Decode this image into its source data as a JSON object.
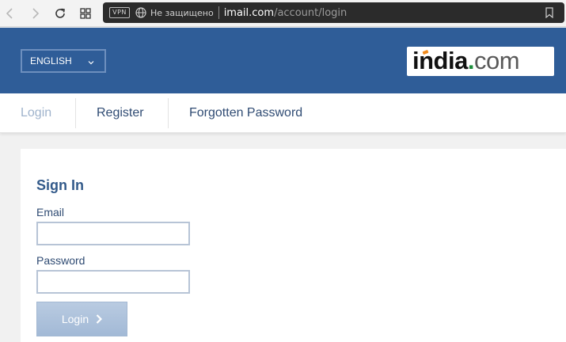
{
  "browser": {
    "vpn_label": "VPN",
    "security_label": "Не защищено",
    "url_host": "imail.com",
    "url_path": "/account/login",
    "icons": [
      "back-icon",
      "forward-icon",
      "reload-icon",
      "tabs-icon",
      "globe-icon",
      "bookmark-icon"
    ]
  },
  "header": {
    "language": "ENGLISH",
    "logo": {
      "india": "india",
      "dot": ".",
      "com": "com"
    },
    "colors": {
      "background": "#2f5d98",
      "logo_dot": "#1b8d3a",
      "logo_flag": "#f08a1c"
    }
  },
  "tabs": [
    {
      "label": "Login",
      "active": true
    },
    {
      "label": "Register",
      "active": false
    },
    {
      "label": "Forgotten Password",
      "active": false
    }
  ],
  "form": {
    "title": "Sign In",
    "email_label": "Email",
    "email_value": "",
    "password_label": "Password",
    "password_value": "",
    "submit_label": "Login"
  }
}
